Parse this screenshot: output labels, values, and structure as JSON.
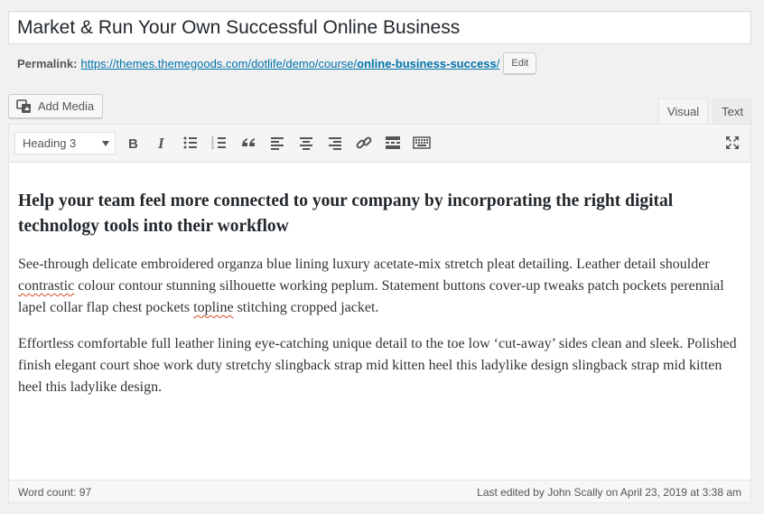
{
  "post": {
    "title": "Market & Run Your Own Successful Online Business"
  },
  "permalink": {
    "label": "Permalink:",
    "url_base": "https://themes.themegoods.com/dotlife/demo/course/",
    "slug": "online-business-success",
    "trailing": "/",
    "edit_label": "Edit"
  },
  "media": {
    "add_media_label": "Add Media",
    "icon": "media-icon"
  },
  "editor_tabs": [
    {
      "label": "Visual",
      "active": true
    },
    {
      "label": "Text",
      "active": false
    }
  ],
  "toolbar": {
    "format_select": "Heading 3",
    "icons": [
      "bold-icon",
      "italic-icon",
      "bullet-list-icon",
      "numbered-list-icon",
      "blockquote-icon",
      "align-left-icon",
      "align-center-icon",
      "align-right-icon",
      "link-icon",
      "read-more-icon",
      "toolbar-toggle-icon",
      "fullscreen-icon"
    ]
  },
  "content": {
    "heading": "Help your team feel more connected to your company by incorporating the right digital technology tools into their workflow",
    "p1_a": "See-through delicate embroidered organza blue lining luxury acetate-mix stretch pleat detailing. Leather detail shoulder ",
    "p1_spell1": "contrastic",
    "p1_b": " colour contour stunning silhouette working peplum. Statement buttons cover-up tweaks patch pockets perennial lapel collar flap chest pockets ",
    "p1_spell2": "topline",
    "p1_c": " stitching cropped jacket.",
    "p2": "Effortless comfortable full leather lining eye-catching unique detail to the toe low ‘cut-away’ sides clean and sleek. Polished finish elegant court shoe work duty stretchy slingback strap mid kitten heel this ladylike design slingback strap mid kitten heel this ladylike design."
  },
  "status": {
    "word_count": "Word count: 97",
    "last_edited": "Last edited by John Scally on April 23, 2019 at 3:38 am"
  },
  "colors": {
    "link": "#0073aa",
    "spellcheck": "#d54e21"
  }
}
